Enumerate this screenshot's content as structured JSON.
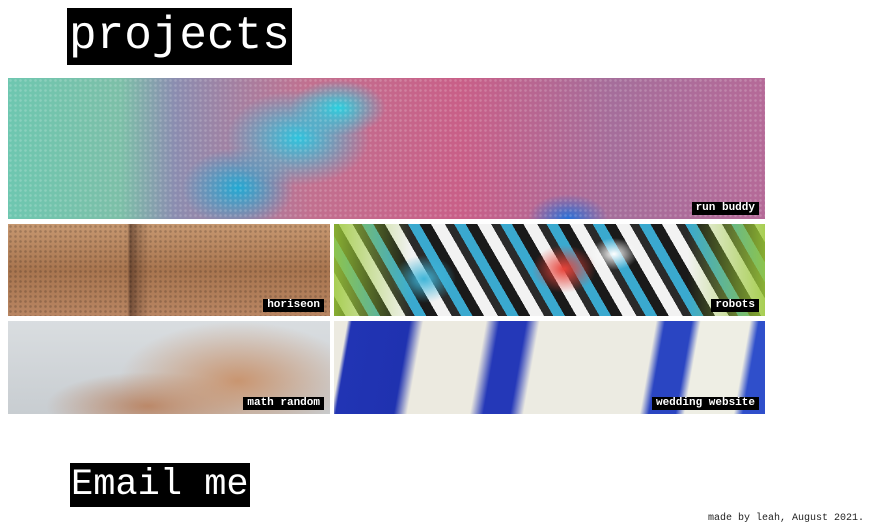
{
  "header": {
    "title": "projects"
  },
  "projects": [
    {
      "label": "run buddy"
    },
    {
      "label": "horiseon"
    },
    {
      "label": "robots"
    },
    {
      "label": "math random"
    },
    {
      "label": "wedding website"
    }
  ],
  "contact": {
    "label": "Email me"
  },
  "footer": {
    "text": "made by leah, August 2021."
  }
}
